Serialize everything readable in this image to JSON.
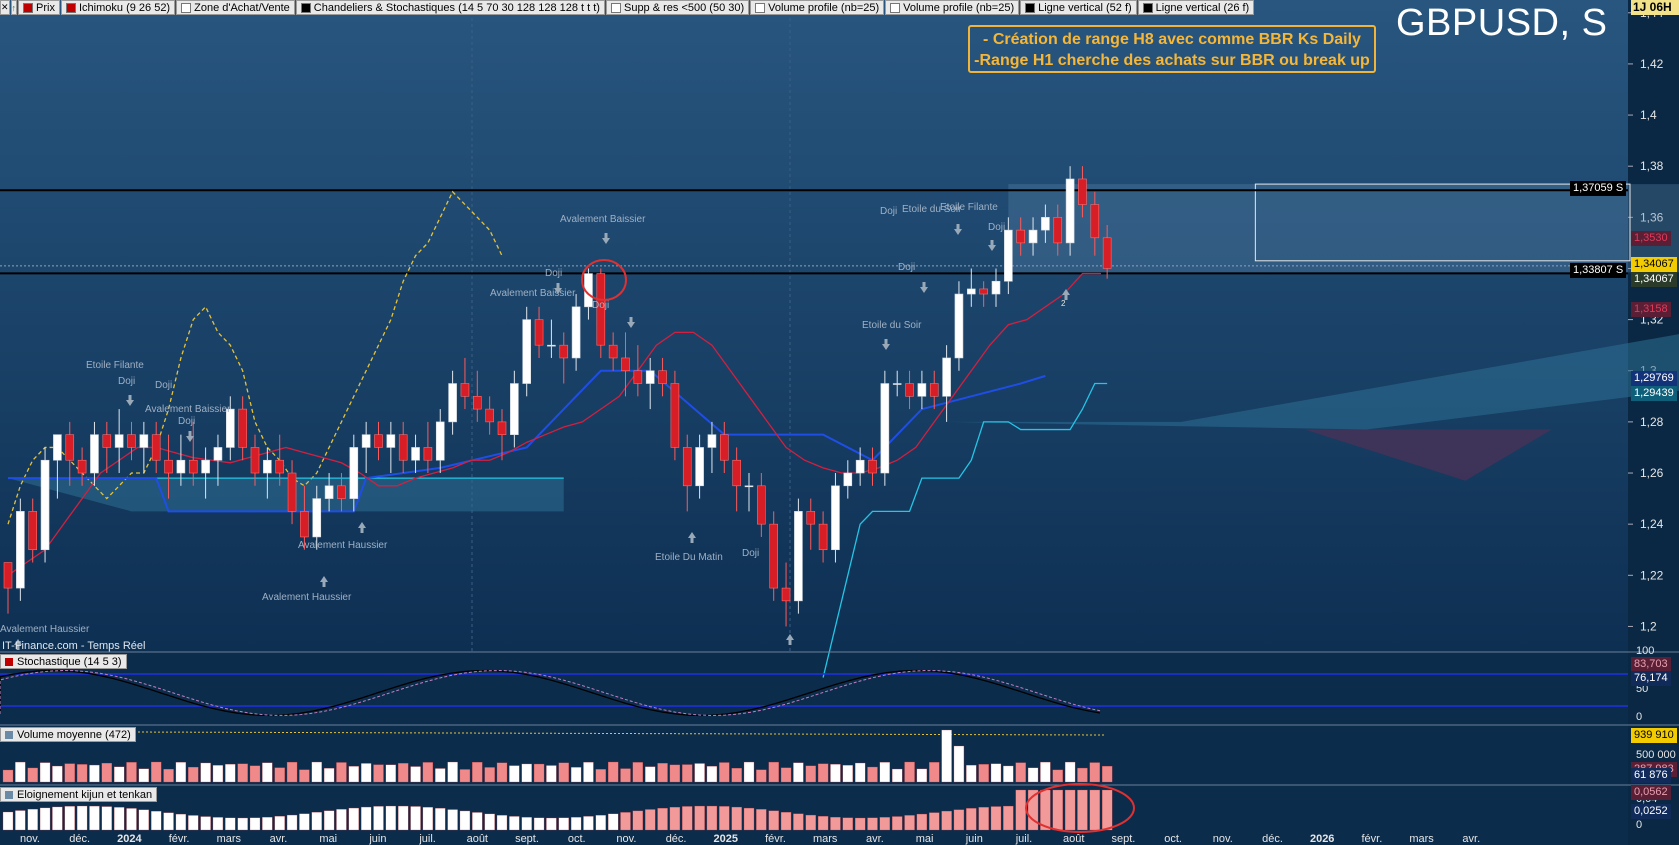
{
  "toolbar": {
    "items": [
      {
        "label": "Prix",
        "color": "#c00000"
      },
      {
        "label": "Ichimoku (9 26 52)",
        "color": "#c00000"
      },
      {
        "label": "Zone d'Achat/Vente",
        "color": "#ffffff"
      },
      {
        "label": "Chandeliers & Stochastiques (14 5 70 30 128 128 128 t t t)",
        "color": "#000000"
      },
      {
        "label": "Supp & res <500 (50 30)",
        "color": "#ffffff"
      },
      {
        "label": "Volume profile (nb=25)",
        "color": "#ffffff"
      },
      {
        "label": "Volume profile (nb=25)",
        "color": "#ffffff"
      },
      {
        "label": "Ligne vertical (52 f)",
        "color": "#000000"
      },
      {
        "label": "Ligne vertical (26 f)",
        "color": "#000000"
      }
    ]
  },
  "symbol": "GBPUSD, S",
  "timeframe": "1J 06H",
  "note": {
    "line1": "- Création de range H8 avec comme BBR Ks Daily",
    "line2": "-Range H1 cherche des achats sur BBR ou break up"
  },
  "source": "IT-Finance.com - Temps Réel",
  "price_axis": {
    "ticks": [
      "1,44",
      "1,42",
      "1,4",
      "1,38",
      "1,36",
      "1,34",
      "1,32",
      "1,3",
      "1,28",
      "1,26",
      "1,24",
      "1,22",
      "1,2"
    ]
  },
  "levels": [
    {
      "label": "1,37059 S",
      "value": 1.37059
    },
    {
      "label": "1,33807 S",
      "value": 1.33807
    }
  ],
  "right_labels": {
    "red_upper": "1,3530",
    "yellow": "1,34067",
    "dark_price": "1,34067",
    "red_lower": "1,3158",
    "kijun_label": "1,29769",
    "ssb_label": "1,29439"
  },
  "colors": {
    "up": "#ffffff",
    "down": "#d71e26",
    "tenkan": "#d51f3f",
    "kijun": "#1f4ee6",
    "chikou": "#e6c23a",
    "ssb": "#23c6e6",
    "kumo_fill": "#2d6f93",
    "note": "#f6b637"
  },
  "annotations": [
    {
      "text": "Avalement Haussier"
    },
    {
      "text": "Etoile Filante"
    },
    {
      "text": "Doji"
    },
    {
      "text": "Doji"
    },
    {
      "text": "Avalement Baissier"
    },
    {
      "text": "Doji"
    },
    {
      "text": "Avalement Haussier"
    },
    {
      "text": "Avalement Haussier"
    },
    {
      "text": "Avalement Baissier"
    },
    {
      "text": "Doji"
    },
    {
      "text": "Avalement Baissier"
    },
    {
      "text": "Doji"
    },
    {
      "text": "Etoile Du Matin"
    },
    {
      "text": "Doji"
    },
    {
      "text": "Doji"
    },
    {
      "text": "Doji"
    },
    {
      "text": "Etoile du Soir"
    },
    {
      "text": "Etoile Filante"
    },
    {
      "text": "Etoile du Soir"
    },
    {
      "text": "Doji"
    }
  ],
  "x_axis": {
    "labels": [
      "nov.",
      "déc.",
      "2024",
      "févr.",
      "mars",
      "avr.",
      "mai",
      "juin",
      "juil.",
      "août",
      "sept.",
      "oct.",
      "nov.",
      "déc.",
      "2025",
      "févr.",
      "mars",
      "avr.",
      "mai",
      "juin",
      "juil.",
      "août",
      "sept.",
      "oct.",
      "nov.",
      "déc.",
      "2026",
      "févr.",
      "mars",
      "avr."
    ]
  },
  "stochastic": {
    "title": "Stochastique (14 5 3)",
    "ticks": [
      "100",
      "50",
      "0"
    ],
    "label1": "83,703",
    "label2": "76,174"
  },
  "volume": {
    "title": "Volume moyenne (472)",
    "label1": "939 910",
    "tick500": "500 000",
    "label2": "287 983",
    "label3": "61 876",
    "tick0": "0"
  },
  "eloignement": {
    "title": "Eloignement kijun et tenkan",
    "label1": "0,0562",
    "tick1": "0,04",
    "label2": "0,0252",
    "tick0": "0"
  },
  "chart_data": {
    "type": "candlestick",
    "interval": "weekly",
    "date_range": [
      "2023-10",
      "2025-07"
    ],
    "y_range": [
      1.19,
      1.445
    ],
    "candles": [
      [
        1.225,
        1.225,
        1.205,
        1.215
      ],
      [
        1.215,
        1.25,
        1.21,
        1.245
      ],
      [
        1.245,
        1.25,
        1.225,
        1.23
      ],
      [
        1.23,
        1.27,
        1.225,
        1.265
      ],
      [
        1.265,
        1.275,
        1.25,
        1.275
      ],
      [
        1.275,
        1.28,
        1.255,
        1.265
      ],
      [
        1.265,
        1.27,
        1.255,
        1.26
      ],
      [
        1.26,
        1.28,
        1.255,
        1.275
      ],
      [
        1.275,
        1.28,
        1.26,
        1.27
      ],
      [
        1.27,
        1.285,
        1.26,
        1.275
      ],
      [
        1.275,
        1.28,
        1.265,
        1.27
      ],
      [
        1.27,
        1.28,
        1.26,
        1.275
      ],
      [
        1.275,
        1.28,
        1.26,
        1.265
      ],
      [
        1.265,
        1.275,
        1.25,
        1.26
      ],
      [
        1.26,
        1.275,
        1.255,
        1.265
      ],
      [
        1.265,
        1.28,
        1.255,
        1.26
      ],
      [
        1.26,
        1.27,
        1.25,
        1.265
      ],
      [
        1.265,
        1.275,
        1.255,
        1.27
      ],
      [
        1.27,
        1.29,
        1.265,
        1.285
      ],
      [
        1.285,
        1.29,
        1.265,
        1.27
      ],
      [
        1.27,
        1.275,
        1.255,
        1.26
      ],
      [
        1.26,
        1.27,
        1.25,
        1.265
      ],
      [
        1.265,
        1.275,
        1.255,
        1.26
      ],
      [
        1.26,
        1.265,
        1.24,
        1.245
      ],
      [
        1.245,
        1.255,
        1.23,
        1.235
      ],
      [
        1.235,
        1.255,
        1.23,
        1.25
      ],
      [
        1.25,
        1.26,
        1.245,
        1.255
      ],
      [
        1.255,
        1.26,
        1.245,
        1.25
      ],
      [
        1.25,
        1.275,
        1.245,
        1.27
      ],
      [
        1.27,
        1.28,
        1.26,
        1.275
      ],
      [
        1.275,
        1.28,
        1.265,
        1.27
      ],
      [
        1.27,
        1.28,
        1.26,
        1.275
      ],
      [
        1.275,
        1.28,
        1.26,
        1.265
      ],
      [
        1.265,
        1.275,
        1.26,
        1.27
      ],
      [
        1.27,
        1.28,
        1.26,
        1.265
      ],
      [
        1.265,
        1.285,
        1.26,
        1.28
      ],
      [
        1.28,
        1.3,
        1.275,
        1.295
      ],
      [
        1.295,
        1.305,
        1.285,
        1.29
      ],
      [
        1.29,
        1.3,
        1.28,
        1.285
      ],
      [
        1.285,
        1.29,
        1.275,
        1.28
      ],
      [
        1.28,
        1.285,
        1.265,
        1.275
      ],
      [
        1.275,
        1.3,
        1.27,
        1.295
      ],
      [
        1.295,
        1.325,
        1.29,
        1.32
      ],
      [
        1.32,
        1.325,
        1.305,
        1.31
      ],
      [
        1.31,
        1.32,
        1.305,
        1.31
      ],
      [
        1.31,
        1.315,
        1.295,
        1.305
      ],
      [
        1.305,
        1.33,
        1.3,
        1.325
      ],
      [
        1.325,
        1.34,
        1.32,
        1.338
      ],
      [
        1.338,
        1.34,
        1.305,
        1.31
      ],
      [
        1.31,
        1.315,
        1.3,
        1.305
      ],
      [
        1.305,
        1.315,
        1.29,
        1.3
      ],
      [
        1.3,
        1.31,
        1.29,
        1.295
      ],
      [
        1.295,
        1.305,
        1.285,
        1.3
      ],
      [
        1.3,
        1.305,
        1.29,
        1.295
      ],
      [
        1.295,
        1.3,
        1.265,
        1.27
      ],
      [
        1.27,
        1.275,
        1.245,
        1.255
      ],
      [
        1.255,
        1.275,
        1.25,
        1.27
      ],
      [
        1.27,
        1.28,
        1.26,
        1.275
      ],
      [
        1.275,
        1.28,
        1.26,
        1.265
      ],
      [
        1.265,
        1.27,
        1.245,
        1.255
      ],
      [
        1.255,
        1.26,
        1.245,
        1.255
      ],
      [
        1.255,
        1.26,
        1.235,
        1.24
      ],
      [
        1.24,
        1.245,
        1.21,
        1.215
      ],
      [
        1.215,
        1.225,
        1.2,
        1.21
      ],
      [
        1.21,
        1.25,
        1.205,
        1.245
      ],
      [
        1.245,
        1.25,
        1.23,
        1.24
      ],
      [
        1.24,
        1.245,
        1.225,
        1.23
      ],
      [
        1.23,
        1.26,
        1.225,
        1.255
      ],
      [
        1.255,
        1.265,
        1.25,
        1.26
      ],
      [
        1.26,
        1.27,
        1.255,
        1.265
      ],
      [
        1.265,
        1.27,
        1.255,
        1.26
      ],
      [
        1.26,
        1.3,
        1.255,
        1.295
      ],
      [
        1.295,
        1.3,
        1.29,
        1.295
      ],
      [
        1.295,
        1.3,
        1.285,
        1.29
      ],
      [
        1.29,
        1.3,
        1.285,
        1.295
      ],
      [
        1.295,
        1.3,
        1.285,
        1.29
      ],
      [
        1.29,
        1.31,
        1.28,
        1.305
      ],
      [
        1.305,
        1.335,
        1.3,
        1.33
      ],
      [
        1.33,
        1.34,
        1.325,
        1.332
      ],
      [
        1.332,
        1.335,
        1.325,
        1.33
      ],
      [
        1.33,
        1.34,
        1.325,
        1.335
      ],
      [
        1.335,
        1.36,
        1.33,
        1.355
      ],
      [
        1.355,
        1.36,
        1.345,
        1.35
      ],
      [
        1.35,
        1.36,
        1.345,
        1.355
      ],
      [
        1.355,
        1.365,
        1.35,
        1.36
      ],
      [
        1.36,
        1.365,
        1.345,
        1.35
      ],
      [
        1.35,
        1.38,
        1.345,
        1.375
      ],
      [
        1.375,
        1.38,
        1.36,
        1.365
      ],
      [
        1.365,
        1.37,
        1.345,
        1.352
      ],
      [
        1.352,
        1.357,
        1.336,
        1.34
      ]
    ],
    "ichimoku": {
      "tenkan": [
        1.22,
        1.225,
        1.23,
        1.24,
        1.25,
        1.26,
        1.265,
        1.27,
        1.27,
        1.268,
        1.266,
        1.265,
        1.264,
        1.266,
        1.268,
        1.27,
        1.268,
        1.266,
        1.264,
        1.26,
        1.255,
        1.255,
        1.258,
        1.26,
        1.262,
        1.265,
        1.265,
        1.268,
        1.272,
        1.275,
        1.278,
        1.28,
        1.285,
        1.29,
        1.3,
        1.31,
        1.315,
        1.315,
        1.31,
        1.3,
        1.29,
        1.28,
        1.27,
        1.265,
        1.262,
        1.26,
        1.26,
        1.262,
        1.265,
        1.27,
        1.28,
        1.29,
        1.3,
        1.31,
        1.318,
        1.32,
        1.325,
        1.33,
        1.338,
        1.338
      ],
      "kijun": [
        1.258,
        1.258,
        1.258,
        1.26,
        1.26,
        1.255,
        1.245,
        1.245,
        1.245,
        1.245,
        1.248,
        1.25,
        1.255,
        1.26,
        1.262,
        1.264,
        1.268,
        1.27,
        1.272,
        1.275,
        1.285,
        1.29,
        1.295,
        1.3,
        1.3,
        1.295,
        1.29,
        1.285,
        1.28,
        1.275,
        1.278,
        1.28,
        1.275,
        1.27,
        1.265,
        1.27,
        1.28,
        1.29,
        1.295,
        1.298
      ],
      "ssb": [
        1.18,
        1.2,
        1.22,
        1.24,
        1.245,
        1.245,
        1.245,
        1.245,
        1.258,
        1.258,
        1.258,
        1.258,
        1.265,
        1.28,
        1.28,
        1.28,
        1.277,
        1.277,
        1.277,
        1.277,
        1.277,
        1.285,
        1.295,
        1.295
      ],
      "chikou": [
        1.24,
        1.255,
        1.265,
        1.27,
        1.27,
        1.265,
        1.26,
        1.255,
        1.25,
        1.255,
        1.26,
        1.26,
        1.27,
        1.285,
        1.305,
        1.32,
        1.325,
        1.315,
        1.31,
        1.3,
        1.28,
        1.27,
        1.265,
        1.258,
        1.255,
        1.26,
        1.27,
        1.28,
        1.29,
        1.3,
        1.31,
        1.32,
        1.335,
        1.345,
        1.35,
        1.36,
        1.37,
        1.365,
        1.36,
        1.355,
        1.345
      ]
    }
  }
}
